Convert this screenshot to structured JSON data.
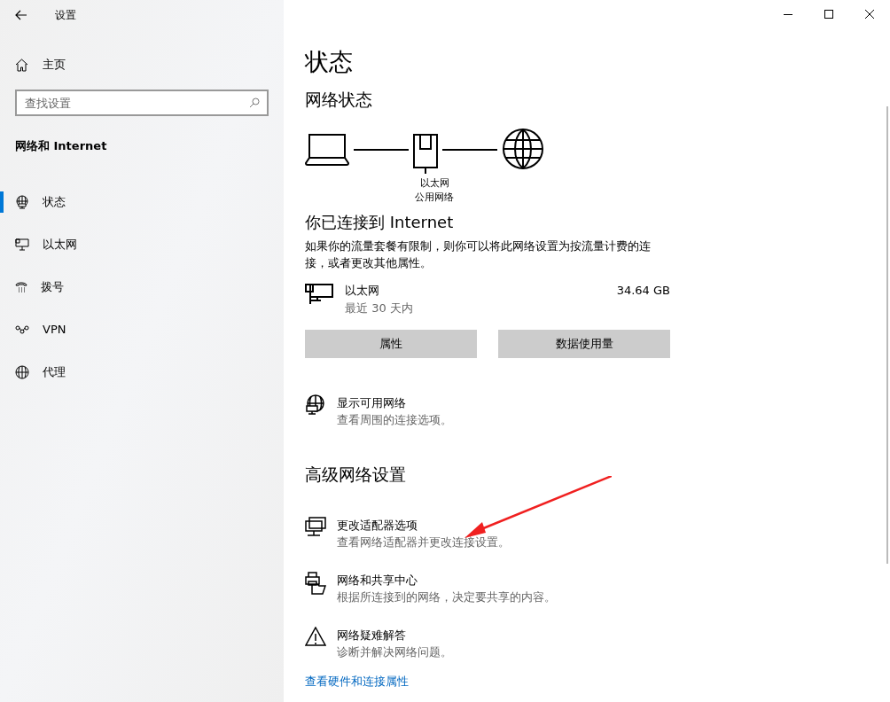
{
  "window": {
    "title": "设置"
  },
  "sidebar": {
    "home": "主页",
    "search": {
      "placeholder": "查找设置"
    },
    "section": "网络和 Internet",
    "items": [
      {
        "label": "状态",
        "selected": true
      },
      {
        "label": "以太网",
        "selected": false
      },
      {
        "label": "拨号",
        "selected": false
      },
      {
        "label": "VPN",
        "selected": false
      },
      {
        "label": "代理",
        "selected": false
      }
    ]
  },
  "page": {
    "title": "状态",
    "network_status": "网络状态",
    "diagram": {
      "adapter": "以太网",
      "profile": "公用网络"
    },
    "connected": "你已连接到 Internet",
    "description": "如果你的流量套餐有限制，则你可以将此网络设置为按流量计费的连接，或者更改其他属性。",
    "usage": {
      "name": "以太网",
      "period": "最近 30 天内",
      "amount": "34.64 GB"
    },
    "buttons": [
      "属性",
      "数据使用量"
    ],
    "show_networks": {
      "title": "显示可用网络",
      "subtitle": "查看周围的连接选项。"
    },
    "advanced_title": "高级网络设置",
    "advanced": [
      {
        "title": "更改适配器选项",
        "subtitle": "查看网络适配器并更改连接设置。"
      },
      {
        "title": "网络和共享中心",
        "subtitle": "根据所连接到的网络，决定要共享的内容。"
      },
      {
        "title": "网络疑难解答",
        "subtitle": "诊断并解决网络问题。"
      }
    ],
    "link": "查看硬件和连接属性"
  }
}
